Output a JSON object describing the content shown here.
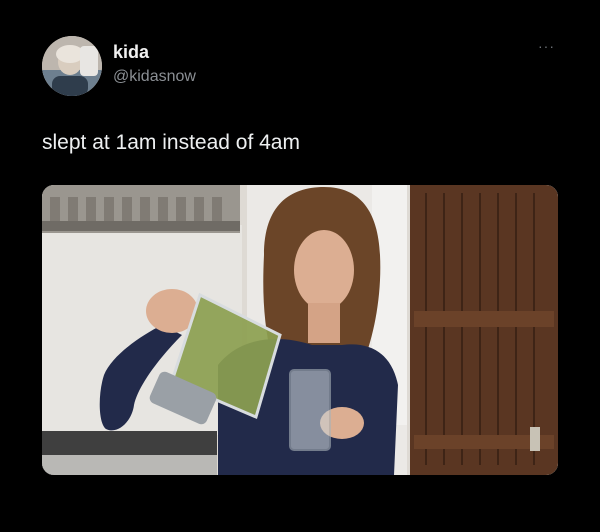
{
  "tweet": {
    "author": {
      "display_name": "kida",
      "handle": "@kidasnow",
      "avatar_icon": "profile-photo"
    },
    "more_options_label": "···",
    "more_icon": "more-horizontal-icon",
    "text": "slept at 1am instead of 4am",
    "media": {
      "type": "photo"
    }
  }
}
